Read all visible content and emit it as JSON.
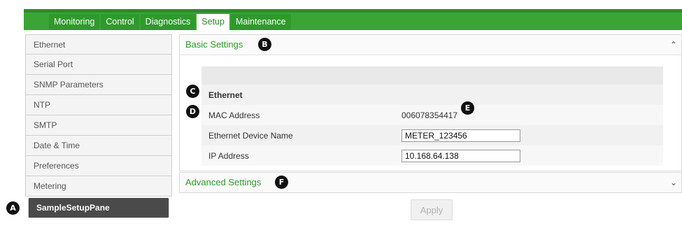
{
  "tabs": [
    "Monitoring",
    "Control",
    "Diagnostics",
    "Setup",
    "Maintenance"
  ],
  "active_tab": "Setup",
  "sidebar": {
    "items": [
      {
        "label": "Ethernet"
      },
      {
        "label": "Serial Port"
      },
      {
        "label": "SNMP Parameters"
      },
      {
        "label": "NTP"
      },
      {
        "label": "SMTP"
      },
      {
        "label": "Date & Time"
      },
      {
        "label": "Preferences"
      },
      {
        "label": "Metering"
      },
      {
        "label": "SampleSetupPane"
      }
    ]
  },
  "basic": {
    "title": "Basic Settings",
    "section_label": "Ethernet",
    "mac_label": "MAC Address",
    "mac_value": "006078354417",
    "device_name_label": "Ethernet Device Name",
    "device_name_value": "METER_123456",
    "ip_label": "IP Address",
    "ip_value": "10.168.64.138"
  },
  "advanced": {
    "title": "Advanced Settings"
  },
  "apply_label": "Apply",
  "markers": {
    "a": "A",
    "b": "B",
    "c": "C",
    "d": "D",
    "e": "E",
    "f": "F"
  }
}
